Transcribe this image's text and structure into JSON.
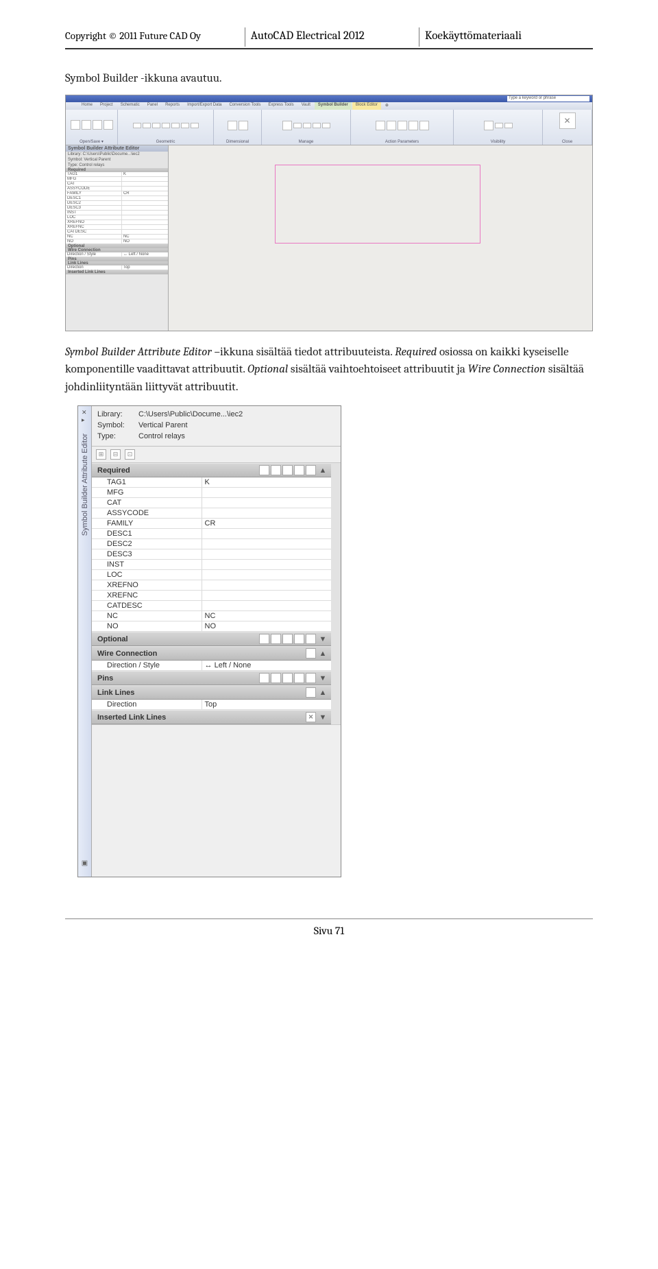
{
  "header": {
    "copyright": "Copyright © 2011 Future CAD Oy",
    "product": "AutoCAD Electrical 2012",
    "doc_type": "Koekäyttömateriaali"
  },
  "body": {
    "intro": "Symbol Builder -ikkuna avautuu.",
    "para2_a": "Symbol Builder Attribute Editor ",
    "para2_b": "–ikkuna sisältää tiedot attribuuteista. ",
    "para2_c": "Required",
    "para2_d": " osiossa on kaikki kyseiselle komponentille vaadittavat attribuutit. ",
    "para2_e": "Optional",
    "para2_f": " sisältää vaihtoehtoiseet attribuutit ja ",
    "para2_g": "Wire Connection",
    "para2_h": " sisältää johdinliityntään liittyvät attribuutit."
  },
  "wide": {
    "search_placeholder": "Type a keyword or phrase",
    "tabs": [
      "Home",
      "Project",
      "Schematic",
      "Panel",
      "Reports",
      "Import/Export Data",
      "Conversion Tools",
      "Express Tools",
      "Vault",
      "Symbol Builder",
      "Block Editor",
      "⊕"
    ],
    "groups": [
      {
        "lbl": "Open/Save ▾",
        "n": 4
      },
      {
        "lbl": "Geometric",
        "n": 7
      },
      {
        "lbl": "Dimensional",
        "n": 3
      },
      {
        "lbl": "Manage",
        "n": 5
      },
      {
        "lbl": "Action Parameters",
        "n": 5
      },
      {
        "lbl": "Visibility",
        "n": 3
      },
      {
        "lbl": "Close",
        "n": 1
      }
    ],
    "panel": {
      "title": "Symbol Builder Attribute Editor",
      "library": "Library: C:\\Users\\Public\\Docume...\\iec2",
      "symbol": "Symbol: Vertical Parent",
      "type": "Type: Control relays",
      "required_label": "Required",
      "required": [
        [
          "TAG1",
          "K"
        ],
        [
          "MFG",
          ""
        ],
        [
          "CAT",
          ""
        ],
        [
          "ASSYCODE",
          ""
        ],
        [
          "FAMILY",
          "CR"
        ],
        [
          "DESC1",
          ""
        ],
        [
          "DESC2",
          ""
        ],
        [
          "DESC3",
          ""
        ],
        [
          "INST",
          ""
        ],
        [
          "LOC",
          ""
        ],
        [
          "XREFNO",
          ""
        ],
        [
          "XREFNC",
          ""
        ],
        [
          "CATDESC",
          ""
        ],
        [
          "NC",
          "NC"
        ],
        [
          "NO",
          "NO"
        ]
      ],
      "optional_label": "Optional",
      "wire_label": "Wire Connection",
      "wire_row": [
        "Direction / Style",
        "↔ Left / None"
      ],
      "pins_label": "Pins",
      "link_label": "Link Lines",
      "link_row": [
        "Direction",
        "Top"
      ],
      "inserted_label": "Inserted Link Lines"
    }
  },
  "detail": {
    "sidebar_title": "Symbol Builder Attribute Editor",
    "library_k": "Library:",
    "library_v": "C:\\Users\\Public\\Docume...\\iec2",
    "symbol_k": "Symbol:",
    "symbol_v": "Vertical Parent",
    "type_k": "Type:",
    "type_v": "Control relays",
    "sec_required": "Required",
    "required": [
      [
        "TAG1",
        "K"
      ],
      [
        "MFG",
        ""
      ],
      [
        "CAT",
        ""
      ],
      [
        "ASSYCODE",
        ""
      ],
      [
        "FAMILY",
        "CR"
      ],
      [
        "DESC1",
        ""
      ],
      [
        "DESC2",
        ""
      ],
      [
        "DESC3",
        ""
      ],
      [
        "INST",
        ""
      ],
      [
        "LOC",
        ""
      ],
      [
        "XREFNO",
        ""
      ],
      [
        "XREFNC",
        ""
      ],
      [
        "CATDESC",
        ""
      ],
      [
        "NC",
        "NC"
      ],
      [
        "NO",
        "NO"
      ]
    ],
    "sec_optional": "Optional",
    "sec_wire": "Wire Connection",
    "wire_row": [
      "Direction / Style",
      "↔ Left / None"
    ],
    "sec_pins": "Pins",
    "sec_link": "Link Lines",
    "link_row": [
      "Direction",
      "Top"
    ],
    "sec_inserted": "Inserted Link Lines"
  },
  "footer": {
    "page": "Sivu 71"
  }
}
